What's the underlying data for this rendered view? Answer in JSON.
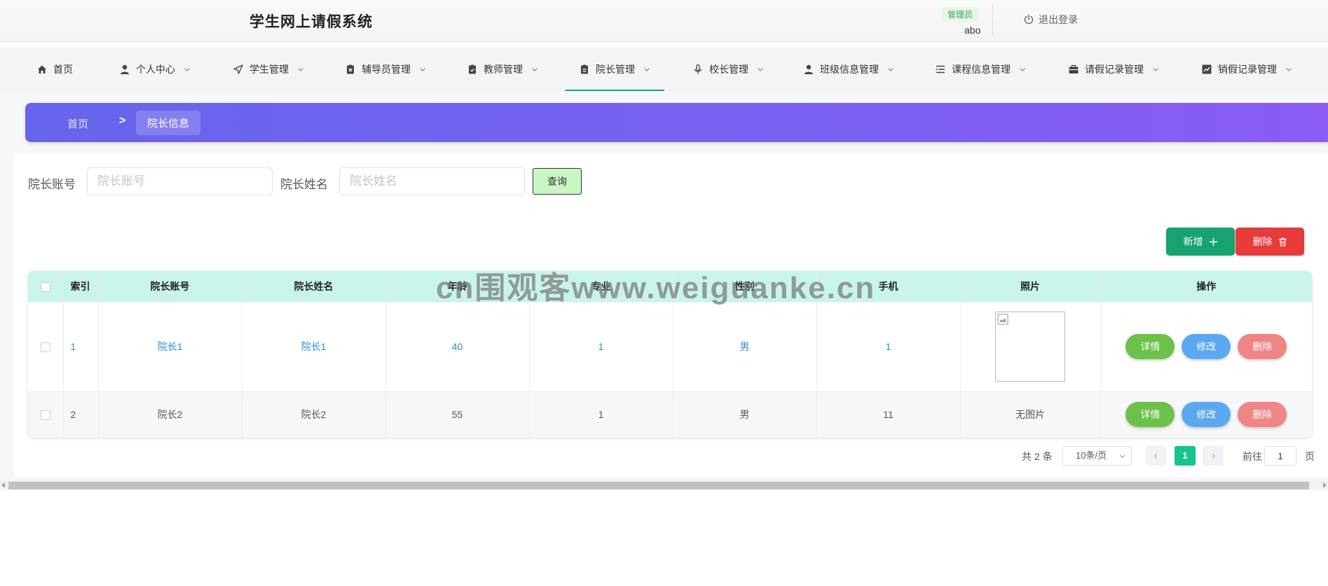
{
  "header": {
    "title": "学生网上请假系统",
    "role": "管理员",
    "username": "abo",
    "logout": "退出登录"
  },
  "nav": {
    "items": [
      {
        "label": "首页",
        "icon": "home-icon"
      },
      {
        "label": "个人中心",
        "icon": "user-icon"
      },
      {
        "label": "学生管理",
        "icon": "send-icon"
      },
      {
        "label": "辅导员管理",
        "icon": "clipboard-x-icon"
      },
      {
        "label": "教师管理",
        "icon": "clipboard-check-icon"
      },
      {
        "label": "院长管理",
        "icon": "clipboard-icon"
      },
      {
        "label": "校长管理",
        "icon": "microphone-icon"
      },
      {
        "label": "班级信息管理",
        "icon": "user-icon"
      },
      {
        "label": "课程信息管理",
        "icon": "list-icon"
      },
      {
        "label": "请假记录管理",
        "icon": "briefcase-icon"
      },
      {
        "label": "销假记录管理",
        "icon": "chart-icon"
      }
    ],
    "active_index": 5,
    "accent": "#14a581"
  },
  "breadcrumb": {
    "home": "首页",
    "separator": ">",
    "current": "院长信息"
  },
  "search": {
    "account_label": "院长账号",
    "account_placeholder": "院长账号",
    "name_label": "院长姓名",
    "name_placeholder": "院长姓名",
    "query_button": "查询"
  },
  "actions": {
    "add": "新增",
    "delete": "删除"
  },
  "table": {
    "headers": [
      "索引",
      "院长账号",
      "院长姓名",
      "年龄",
      "专业",
      "性别",
      "手机",
      "照片",
      "操作"
    ],
    "rows": [
      {
        "index": "1",
        "account": "院长1",
        "name": "院长1",
        "age": "40",
        "major": "1",
        "gender": "男",
        "phone": "1",
        "photo": ""
      },
      {
        "index": "2",
        "account": "院长2",
        "name": "院长2",
        "age": "55",
        "major": "1",
        "gender": "男",
        "phone": "11",
        "photo": "无图片"
      }
    ],
    "row_actions": {
      "detail": "详情",
      "edit": "修改",
      "delete": "删除"
    }
  },
  "pagination": {
    "total": "共 2 条",
    "page_size": "10条/页",
    "current_page": "1",
    "goto_label": "前往",
    "goto_value": "1",
    "page_suffix": "页"
  },
  "watermark": "cn围观客www.weiguanke.cn"
}
